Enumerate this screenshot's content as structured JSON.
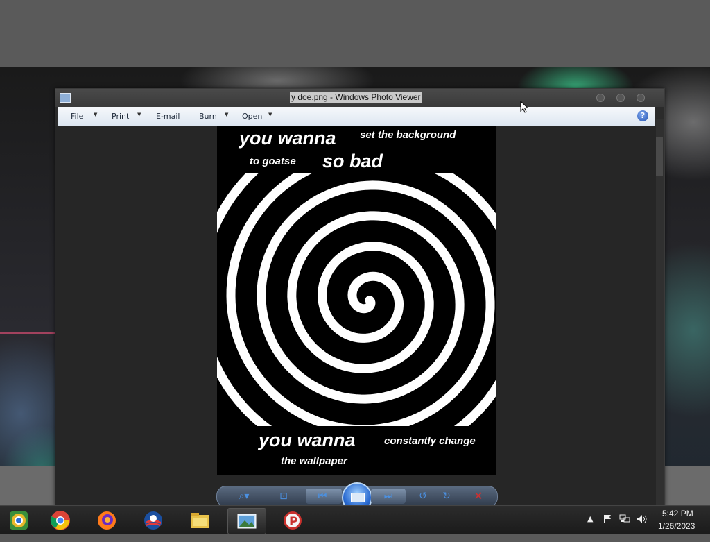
{
  "window": {
    "title": "y doe.png - Windows Photo Viewer"
  },
  "menu": {
    "items": [
      {
        "label": "File",
        "has_dropdown": true
      },
      {
        "label": "Print",
        "has_dropdown": true
      },
      {
        "label": "E-mail",
        "has_dropdown": false
      },
      {
        "label": "Burn",
        "has_dropdown": true
      },
      {
        "label": "Open",
        "has_dropdown": true
      }
    ],
    "help_icon": "help-icon"
  },
  "photo": {
    "captions": {
      "top_left": "you wanna",
      "top_right": "set the background",
      "mid_left": "to goatse",
      "mid_right": "so bad",
      "bottom_left": "you wanna",
      "bottom_right": "constantly change",
      "bottom_last": "the wallpaper"
    }
  },
  "controls": {
    "icons": [
      "zoom-icon",
      "actual-size-icon",
      "previous-icon",
      "slideshow-icon",
      "next-icon",
      "rotate-counterclockwise-icon",
      "rotate-clockwise-icon",
      "delete-icon"
    ]
  },
  "taskbar": {
    "apps": [
      {
        "name": "chrome-canary-icon",
        "active": false
      },
      {
        "name": "chrome-icon",
        "active": false
      },
      {
        "name": "firefox-icon",
        "active": false
      },
      {
        "name": "obama-logo-icon",
        "active": false
      },
      {
        "name": "file-explorer-icon",
        "active": false
      },
      {
        "name": "photo-viewer-icon",
        "active": true
      },
      {
        "name": "p-app-icon",
        "active": false
      }
    ],
    "clock": {
      "time": "5:42 PM",
      "date": "1/26/2023"
    }
  },
  "colors": {
    "menubar_top": "#f6f8fb",
    "menubar_bottom": "#dde6f1",
    "window_bg": "#2b2b2b",
    "accent_blue": "#4b90e0",
    "delete_red": "#d03030"
  }
}
